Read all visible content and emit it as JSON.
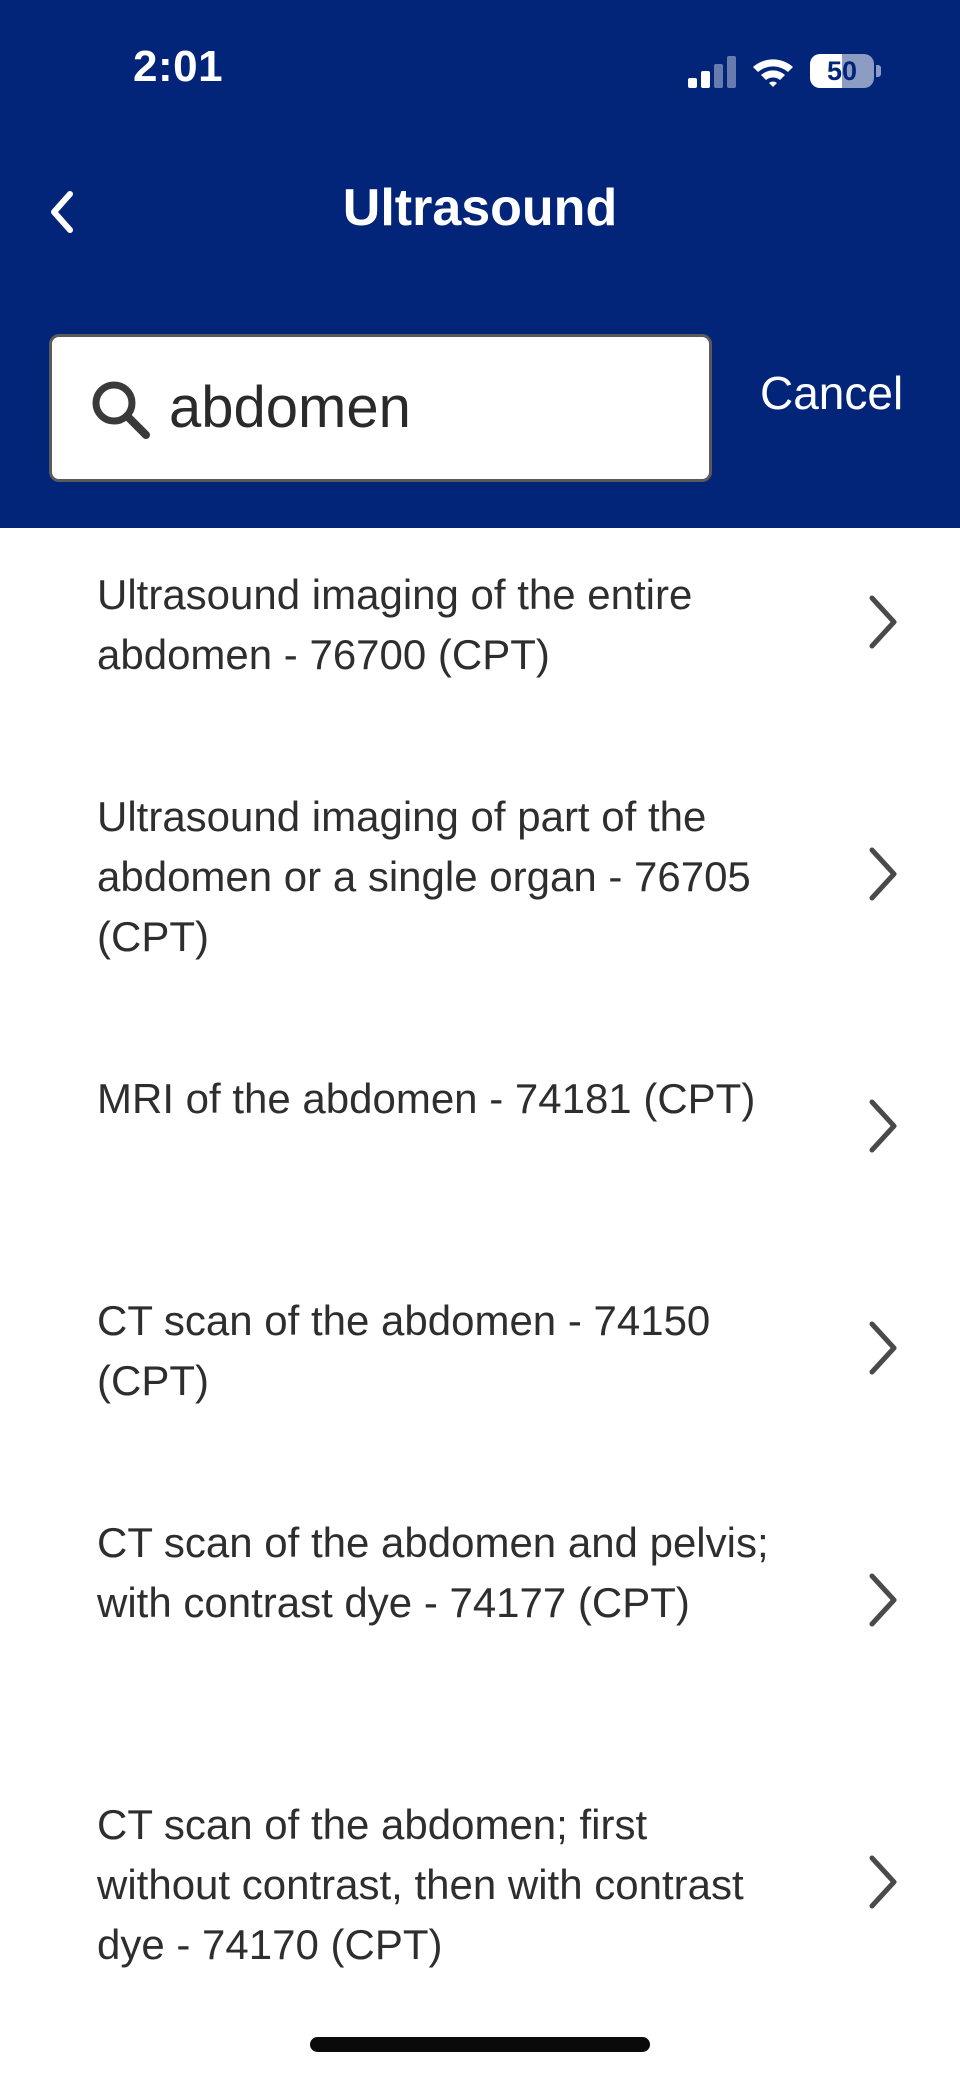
{
  "status_bar": {
    "time": "2:01",
    "battery_level": "50"
  },
  "header": {
    "title": "Ultrasound",
    "back_icon": "chevron-left-icon"
  },
  "search": {
    "value": "abdomen",
    "icon": "search-icon",
    "cancel_label": "Cancel"
  },
  "results": [
    {
      "label": "Ultrasound imaging of the entire abdomen - 76700 (CPT)"
    },
    {
      "label": "Ultrasound imaging of part of the abdomen or a single organ - 76705 (CPT)"
    },
    {
      "label": "MRI of the abdomen - 74181 (CPT)"
    },
    {
      "label": "CT scan of the abdomen - 74150 (CPT)"
    },
    {
      "label": "CT scan of the abdomen and pelvis; with contrast dye - 74177 (CPT)"
    },
    {
      "label": "CT scan of the abdomen; first without contrast, then with contrast dye - 74170 (CPT)"
    }
  ],
  "colors": {
    "header_background": "#022479",
    "text": "#2e2e2e",
    "chevron": "#4a4a4a"
  }
}
